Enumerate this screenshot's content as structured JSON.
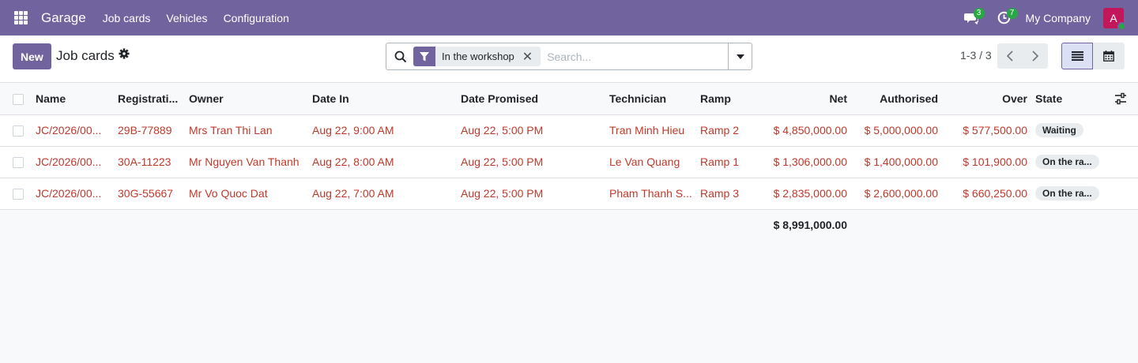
{
  "navbar": {
    "app_name": "Garage",
    "menu": [
      "Job cards",
      "Vehicles",
      "Configuration"
    ],
    "messages_count": "3",
    "activities_count": "7",
    "company": "My Company",
    "avatar_initial": "A",
    "bg_color": "#71639e"
  },
  "control": {
    "new_label": "New",
    "title": "Job cards",
    "facet_label": "In the workshop",
    "search_placeholder": "Search...",
    "pager_text": "1-3 / 3"
  },
  "table": {
    "headers": {
      "name": "Name",
      "registration": "Registrati...",
      "owner": "Owner",
      "date_in": "Date In",
      "date_promised": "Date Promised",
      "technician": "Technician",
      "ramp": "Ramp",
      "net": "Net",
      "authorised": "Authorised",
      "over": "Over",
      "state": "State"
    },
    "rows": [
      {
        "name": "JC/2026/00...",
        "registration": "29B-77889",
        "owner": "Mrs Tran Thi Lan",
        "date_in": "Aug 22, 9:00 AM",
        "date_promised": "Aug 22, 5:00 PM",
        "technician": "Tran Minh Hieu",
        "ramp": "Ramp 2",
        "net": "$ 4,850,000.00",
        "authorised": "$ 5,000,000.00",
        "over": "$ 577,500.00",
        "state": "Waiting"
      },
      {
        "name": "JC/2026/00...",
        "registration": "30A-11223",
        "owner": "Mr Nguyen Van Thanh",
        "date_in": "Aug 22, 8:00 AM",
        "date_promised": "Aug 22, 5:00 PM",
        "technician": "Le Van Quang",
        "ramp": "Ramp 1",
        "net": "$ 1,306,000.00",
        "authorised": "$ 1,400,000.00",
        "over": "$ 101,900.00",
        "state": "On the ra..."
      },
      {
        "name": "JC/2026/00...",
        "registration": "30G-55667",
        "owner": "Mr Vo Quoc Dat",
        "date_in": "Aug 22, 7:00 AM",
        "date_promised": "Aug 22, 5:00 PM",
        "technician": "Pham Thanh S...",
        "ramp": "Ramp 3",
        "net": "$ 2,835,000.00",
        "authorised": "$ 2,600,000.00",
        "over": "$ 660,250.00",
        "state": "On the ra..."
      }
    ],
    "total_net": "$ 8,991,000.00"
  }
}
